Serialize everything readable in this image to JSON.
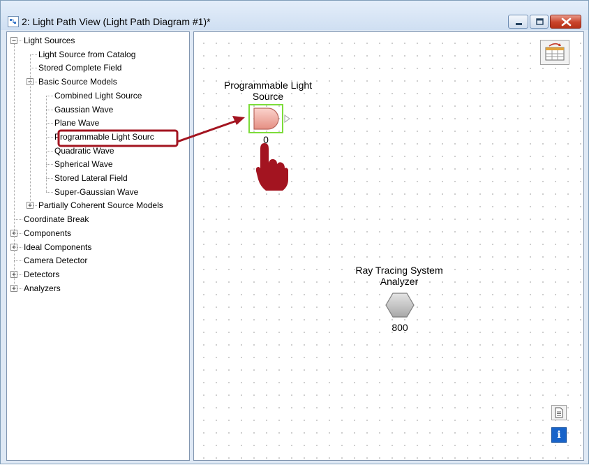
{
  "window": {
    "title": "2: Light Path View (Light Path Diagram #1)*",
    "controls": [
      "minimize-icon",
      "maximize-icon",
      "close-icon"
    ]
  },
  "tree": {
    "items": [
      {
        "label": "Light Sources",
        "level": 0,
        "expander": "minus"
      },
      {
        "label": "Light Source from Catalog",
        "level": 1
      },
      {
        "label": "Stored Complete Field",
        "level": 1
      },
      {
        "label": "Basic Source Models",
        "level": 1,
        "expander": "minus"
      },
      {
        "label": "Combined Light Source",
        "level": 2
      },
      {
        "label": "Gaussian Wave",
        "level": 2
      },
      {
        "label": "Plane Wave",
        "level": 2
      },
      {
        "label": "Programmable Light Sourc",
        "level": 2,
        "highlighted": true
      },
      {
        "label": "Quadratic Wave",
        "level": 2
      },
      {
        "label": "Spherical Wave",
        "level": 2
      },
      {
        "label": "Stored Lateral Field",
        "level": 2
      },
      {
        "label": "Super-Gaussian Wave",
        "level": 2
      },
      {
        "label": "Partially Coherent Source Models",
        "level": 1,
        "expander": "plus"
      },
      {
        "label": "Coordinate Break",
        "level": 0
      },
      {
        "label": "Components",
        "level": 0,
        "expander": "plus"
      },
      {
        "label": "Ideal Components",
        "level": 0,
        "expander": "plus"
      },
      {
        "label": "Camera Detector",
        "level": 0
      },
      {
        "label": "Detectors",
        "level": 0,
        "expander": "plus"
      },
      {
        "label": "Analyzers",
        "level": 0,
        "expander": "plus"
      }
    ]
  },
  "canvas": {
    "light_source": {
      "label": "Programmable Light Source",
      "number": "0",
      "icon": "light-source-icon"
    },
    "analyzer": {
      "label": "Ray Tracing System Analyzer",
      "number": "800",
      "icon": "analyzer-hexagon-icon"
    },
    "tools": [
      "table-view-icon",
      "document-icon",
      "info-icon"
    ],
    "info_glyph": "i"
  },
  "annotation": {
    "highlight_color": "#a31420",
    "selection_color": "#7ddc3a",
    "icons": [
      "arrow-icon",
      "hand-cursor-icon"
    ]
  }
}
